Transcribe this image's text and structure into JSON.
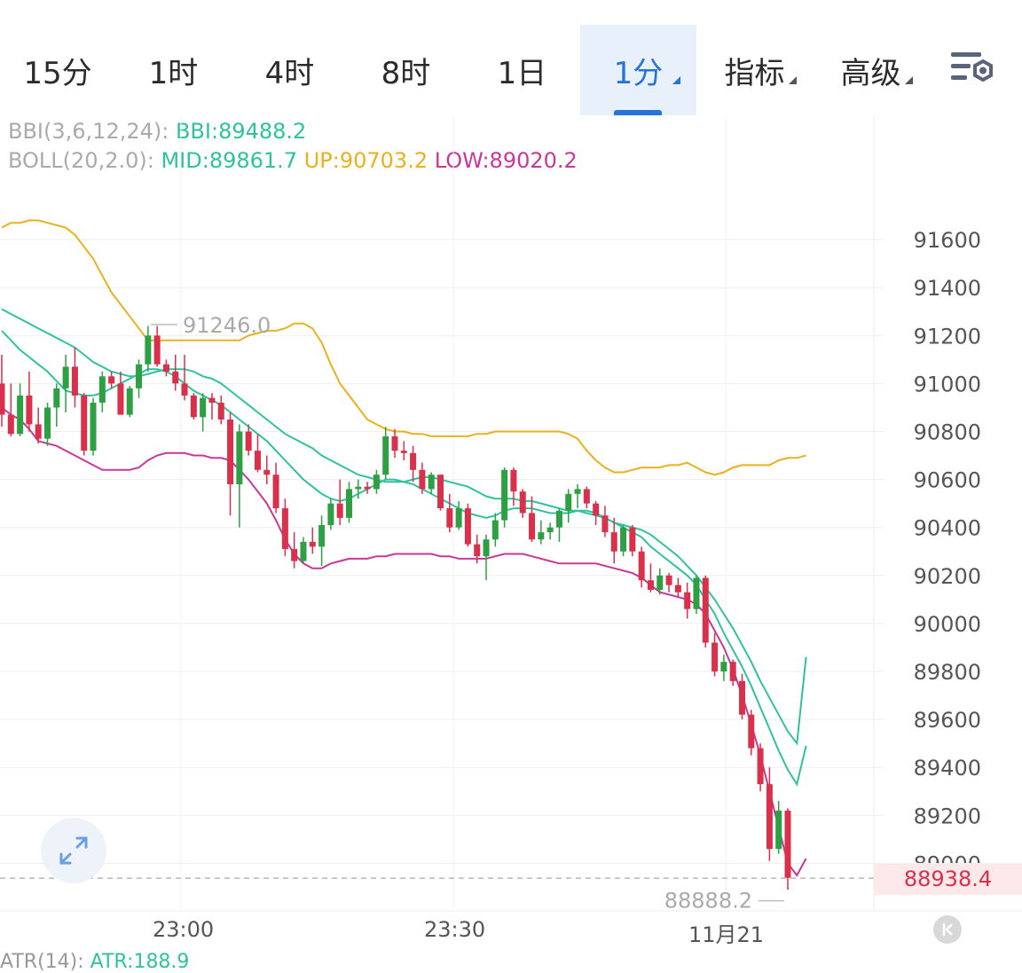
{
  "tabs": [
    {
      "label": "15分"
    },
    {
      "label": "1时"
    },
    {
      "label": "4时"
    },
    {
      "label": "8时"
    },
    {
      "label": "1日"
    },
    {
      "label": "1分",
      "active": true
    },
    {
      "label": "指标"
    },
    {
      "label": "高级"
    }
  ],
  "settings_icon": "chart-settings-icon",
  "indicators": {
    "bbi": {
      "label": "BBI(3,6,12,24):",
      "value_text": "BBI:89488.2"
    },
    "boll": {
      "label": "BOLL(20,2.0):",
      "mid_text": "MID:89861.7",
      "up_text": "UP:90703.2",
      "low_text": "LOW:89020.2"
    }
  },
  "colors": {
    "up": "#2ea043",
    "down": "#d9304c",
    "boll_up": "#e8b21e",
    "boll_mid": "#30c29c",
    "bbi": "#30c29c",
    "boll_low": "#c8389a",
    "accent": "#2673d9"
  },
  "chart_data": {
    "type": "candlestick",
    "y_ticks": [
      "91600",
      "91400",
      "91200",
      "91000",
      "90800",
      "90600",
      "90400",
      "90200",
      "90000",
      "89800",
      "89600",
      "89400",
      "89200",
      "89000"
    ],
    "ylim": [
      88840,
      91750
    ],
    "x_labels": [
      "23:00",
      "23:30",
      "11月21"
    ],
    "high_marker": "91246.0",
    "low_marker": "88888.2",
    "last_price": "88938.4",
    "candles": [
      [
        91000,
        91120,
        90820,
        90870
      ],
      [
        90870,
        91000,
        90780,
        90790
      ],
      [
        90790,
        91000,
        90780,
        90950
      ],
      [
        90950,
        91050,
        90800,
        90830
      ],
      [
        90830,
        90900,
        90750,
        90770
      ],
      [
        90770,
        90920,
        90740,
        90900
      ],
      [
        90900,
        91000,
        90820,
        90980
      ],
      [
        90980,
        91120,
        90880,
        91070
      ],
      [
        91070,
        91150,
        90900,
        90950
      ],
      [
        90950,
        90960,
        90700,
        90720
      ],
      [
        90720,
        90940,
        90700,
        90920
      ],
      [
        90920,
        91050,
        90880,
        91030
      ],
      [
        91030,
        91050,
        90980,
        91000
      ],
      [
        91000,
        91050,
        90870,
        90870
      ],
      [
        90870,
        90990,
        90860,
        90980
      ],
      [
        90980,
        91100,
        90940,
        91080
      ],
      [
        91080,
        91240,
        91050,
        91200
      ],
      [
        91200,
        91240,
        91070,
        91080
      ],
      [
        91080,
        91100,
        91030,
        91050
      ],
      [
        91050,
        91120,
        90970,
        91000
      ],
      [
        91000,
        91120,
        90930,
        90950
      ],
      [
        90950,
        90960,
        90850,
        90860
      ],
      [
        90860,
        90960,
        90800,
        90940
      ],
      [
        90940,
        90960,
        90850,
        90920
      ],
      [
        90920,
        90950,
        90830,
        90850
      ],
      [
        90850,
        90880,
        90450,
        90580
      ],
      [
        90580,
        90830,
        90400,
        90800
      ],
      [
        90800,
        90830,
        90700,
        90720
      ],
      [
        90720,
        90790,
        90630,
        90640
      ],
      [
        90640,
        90700,
        90580,
        90620
      ],
      [
        90620,
        90670,
        90460,
        90480
      ],
      [
        90480,
        90520,
        90280,
        90310
      ],
      [
        90310,
        90380,
        90230,
        90260
      ],
      [
        90260,
        90360,
        90250,
        90340
      ],
      [
        90340,
        90400,
        90290,
        90320
      ],
      [
        90320,
        90450,
        90240,
        90410
      ],
      [
        90410,
        90520,
        90390,
        90500
      ],
      [
        90500,
        90600,
        90410,
        90440
      ],
      [
        90440,
        90590,
        90420,
        90560
      ],
      [
        90560,
        90600,
        90520,
        90570
      ],
      [
        90570,
        90590,
        90540,
        90560
      ],
      [
        90560,
        90640,
        90540,
        90620
      ],
      [
        90620,
        90820,
        90600,
        90780
      ],
      [
        90780,
        90810,
        90690,
        90720
      ],
      [
        90720,
        90760,
        90680,
        90710
      ],
      [
        90710,
        90740,
        90590,
        90640
      ],
      [
        90640,
        90670,
        90540,
        90560
      ],
      [
        90560,
        90630,
        90540,
        90620
      ],
      [
        90620,
        90620,
        90470,
        90480
      ],
      [
        90480,
        90540,
        90380,
        90400
      ],
      [
        90400,
        90510,
        90390,
        90480
      ],
      [
        90480,
        90500,
        90320,
        90330
      ],
      [
        90330,
        90370,
        90250,
        90280
      ],
      [
        90280,
        90370,
        90180,
        90350
      ],
      [
        90350,
        90460,
        90320,
        90430
      ],
      [
        90430,
        90650,
        90400,
        90640
      ],
      [
        90640,
        90650,
        90490,
        90550
      ],
      [
        90550,
        90560,
        90440,
        90460
      ],
      [
        90460,
        90530,
        90340,
        90350
      ],
      [
        90350,
        90430,
        90330,
        90380
      ],
      [
        90380,
        90420,
        90350,
        90400
      ],
      [
        90400,
        90480,
        90340,
        90470
      ],
      [
        90470,
        90560,
        90420,
        90540
      ],
      [
        90540,
        90580,
        90480,
        90560
      ],
      [
        90560,
        90570,
        90480,
        90500
      ],
      [
        90500,
        90510,
        90410,
        90450
      ],
      [
        90450,
        90490,
        90360,
        90380
      ],
      [
        90380,
        90440,
        90250,
        90300
      ],
      [
        90300,
        90410,
        90280,
        90400
      ],
      [
        90400,
        90410,
        90280,
        90300
      ],
      [
        90300,
        90320,
        90150,
        90180
      ],
      [
        90180,
        90250,
        90130,
        90140
      ],
      [
        90140,
        90230,
        90120,
        90200
      ],
      [
        90200,
        90210,
        90130,
        90160
      ],
      [
        90160,
        90190,
        90110,
        90130
      ],
      [
        90130,
        90170,
        90020,
        90060
      ],
      [
        90060,
        90200,
        90040,
        90190
      ],
      [
        90190,
        90200,
        89900,
        89920
      ],
      [
        89920,
        89960,
        89780,
        89800
      ],
      [
        89800,
        89870,
        89760,
        89840
      ],
      [
        89840,
        89850,
        89740,
        89760
      ],
      [
        89760,
        89790,
        89600,
        89620
      ],
      [
        89620,
        89640,
        89450,
        89480
      ],
      [
        89480,
        89500,
        89300,
        89330
      ],
      [
        89330,
        89400,
        89010,
        89060
      ],
      [
        89060,
        89260,
        89040,
        89220
      ],
      [
        89220,
        89230,
        88890,
        88940
      ]
    ],
    "boll_up": [
      91650,
      91670,
      91670,
      91680,
      91680,
      91670,
      91660,
      91650,
      91620,
      91570,
      91520,
      91450,
      91380,
      91330,
      91280,
      91230,
      91180,
      91180,
      91180,
      91180,
      91180,
      91180,
      91180,
      91180,
      91180,
      91180,
      91180,
      91200,
      91210,
      91220,
      91220,
      91230,
      91250,
      91250,
      91230,
      91170,
      91080,
      91000,
      90950,
      90900,
      90850,
      90830,
      90810,
      90800,
      90800,
      90790,
      90790,
      90780,
      90780,
      90780,
      90780,
      90780,
      90790,
      90790,
      90800,
      90800,
      90800,
      90800,
      90800,
      90800,
      90800,
      90800,
      90790,
      90770,
      90720,
      90680,
      90650,
      90630,
      90630,
      90640,
      90650,
      90650,
      90650,
      90660,
      90660,
      90670,
      90650,
      90630,
      90620,
      90630,
      90650,
      90660,
      90660,
      90660,
      90660,
      90680,
      90690,
      90690,
      90700
    ],
    "boll_mid": [
      91310,
      91290,
      91270,
      91250,
      91230,
      91210,
      91190,
      91170,
      91150,
      91120,
      91090,
      91070,
      91050,
      91040,
      91030,
      91030,
      91040,
      91050,
      91060,
      91060,
      91060,
      91050,
      91030,
      91020,
      91000,
      90970,
      90940,
      90910,
      90880,
      90850,
      90820,
      90790,
      90770,
      90750,
      90730,
      90700,
      90680,
      90660,
      90640,
      90620,
      90610,
      90600,
      90590,
      90590,
      90590,
      90600,
      90610,
      90610,
      90600,
      90590,
      90580,
      90570,
      90550,
      90530,
      90520,
      90520,
      90520,
      90510,
      90510,
      90500,
      90490,
      90480,
      90470,
      90470,
      90460,
      90450,
      90440,
      90420,
      90410,
      90400,
      90390,
      90370,
      90340,
      90310,
      90280,
      90240,
      90200,
      90150,
      90100,
      90040,
      89980,
      89910,
      89840,
      89760,
      89690,
      89620,
      89550,
      89500,
      89860
    ],
    "bbi": [
      91220,
      91180,
      91140,
      91110,
      91080,
      91050,
      91010,
      90970,
      90960,
      90950,
      90950,
      90960,
      90980,
      91000,
      91020,
      91040,
      91060,
      91060,
      91050,
      91030,
      91000,
      90970,
      90950,
      90930,
      90910,
      90880,
      90850,
      90820,
      90790,
      90760,
      90720,
      90680,
      90640,
      90600,
      90570,
      90540,
      90520,
      90510,
      90520,
      90540,
      90560,
      90580,
      90600,
      90600,
      90590,
      90580,
      90560,
      90540,
      90520,
      90500,
      90480,
      90460,
      90450,
      90440,
      90450,
      90470,
      90480,
      90480,
      90480,
      90470,
      90460,
      90460,
      90460,
      90470,
      90470,
      90460,
      90440,
      90420,
      90400,
      90380,
      90360,
      90320,
      90290,
      90260,
      90230,
      90200,
      90160,
      90100,
      90040,
      89960,
      89890,
      89820,
      89740,
      89650,
      89560,
      89470,
      89390,
      89330,
      89490
    ],
    "boll_low": [
      90900,
      90870,
      90850,
      90810,
      90760,
      90750,
      90740,
      90720,
      90700,
      90680,
      90660,
      90640,
      90640,
      90640,
      90640,
      90650,
      90680,
      90700,
      90710,
      90710,
      90710,
      90700,
      90700,
      90690,
      90690,
      90680,
      90640,
      90600,
      90550,
      90500,
      90430,
      90350,
      90290,
      90250,
      90230,
      90230,
      90250,
      90260,
      90270,
      90270,
      90270,
      90280,
      90280,
      90290,
      90290,
      90290,
      90290,
      90290,
      90280,
      90280,
      90270,
      90270,
      90270,
      90270,
      90280,
      90290,
      90290,
      90290,
      90280,
      90270,
      90260,
      90250,
      90250,
      90250,
      90250,
      90250,
      90240,
      90230,
      90220,
      90210,
      90190,
      90160,
      90130,
      90120,
      90110,
      90100,
      90080,
      90040,
      89970,
      89900,
      89810,
      89700,
      89580,
      89450,
      89300,
      89150,
      89000,
      88950,
      89020
    ]
  },
  "atr": {
    "label": "ATR(14):",
    "value_text": "ATR:188.9"
  },
  "icons": {
    "expand": "expand-arrows-icon",
    "scroll": "scroll-to-latest-icon"
  }
}
